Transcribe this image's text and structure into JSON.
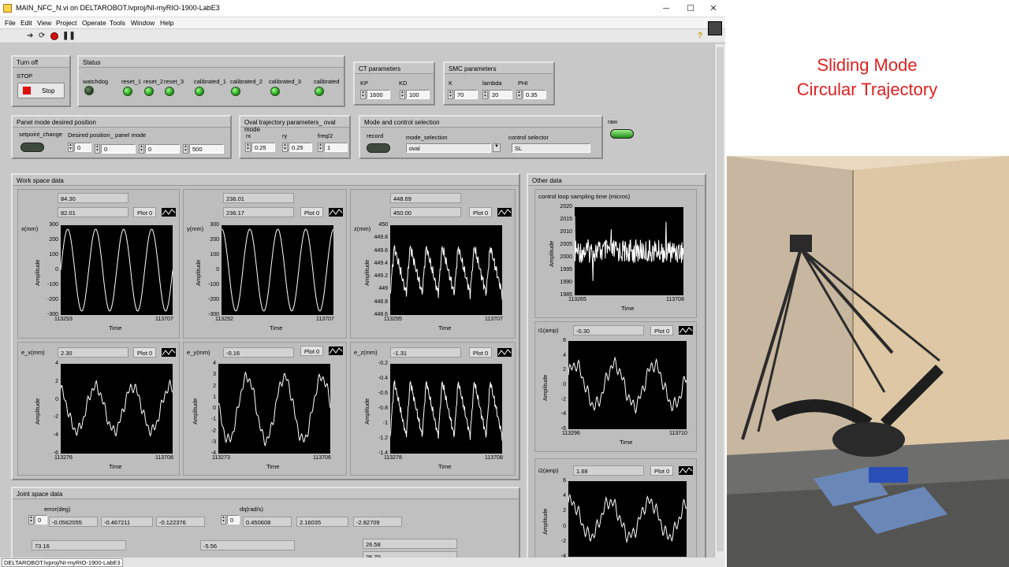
{
  "window": {
    "title": "MAIN_NFC_N.vi on DELTAROBOT.lvproj/NI-myRIO-1900-LabE3"
  },
  "menu": [
    "File",
    "Edit",
    "View",
    "Project",
    "Operate",
    "Tools",
    "Window",
    "Help"
  ],
  "status_path": "DELTAROBOT.lvproj/NI-myRIO-1900-LabE3",
  "turnoff": {
    "title": "Turn off",
    "stop_label": "STOP",
    "stop_btn": "Stop"
  },
  "status": {
    "title": "Status",
    "watchdog": "watchdog",
    "reset1": "reset_1",
    "reset2": "reset_2",
    "reset3": "reset_3",
    "cal1": "calibrated_1",
    "cal2": "calibrated_2",
    "cal3": "calibrated_3",
    "cal": "calibrated"
  },
  "ct": {
    "title": "CT parameters",
    "kp_label": "KP",
    "kp": "1600",
    "kd_label": "KD",
    "kd": "100"
  },
  "smc": {
    "title": "SMC parameters",
    "k_label": "K",
    "k": "70",
    "lambda_label": "lambda",
    "lambda": "20",
    "phi_label": "PHI",
    "phi": "0.35"
  },
  "panelmode": {
    "title": "Panel mode desired position",
    "setpoint": "setpoint_change",
    "desired": "Desired position_ panel mode",
    "idx": "0",
    "v1": "0",
    "v2": "0",
    "v3": "500"
  },
  "oval": {
    "title": "Oval trajectory parameters_ oval mode",
    "rx_label": "rx",
    "rx": "0.25",
    "ry_label": "ry",
    "ry": "0.25",
    "freq_label": "freq/2",
    "freq": "1"
  },
  "mode": {
    "title": "Mode and control selection",
    "record": "record",
    "mode_label": "mode_selection",
    "mode_value": "oval",
    "ctrl_label": "control selector",
    "ctrl_value": "SL"
  },
  "raw": "raw",
  "workspace": {
    "title": "Work space data",
    "plot_btn": "Plot 0",
    "amp": "Amplitude",
    "time": "Time",
    "x": {
      "label": "x(mm)",
      "v1": "84.30",
      "v2": "82.01",
      "yticks": [
        "300",
        "200",
        "100",
        "0",
        "-100",
        "-200",
        "-300"
      ],
      "xmin": "113293",
      "xmax": "113707"
    },
    "y": {
      "label": "y(mm)",
      "v1": "236.01",
      "v2": "236.17",
      "yticks": [
        "300",
        "200",
        "100",
        "0",
        "-100",
        "-200",
        "-300"
      ],
      "xmin": "113292",
      "xmax": "113707"
    },
    "z": {
      "label": "z(mm)",
      "v1": "448.69",
      "v2": "450.00",
      "yticks": [
        "450",
        "449.8",
        "449.6",
        "449.4",
        "449.2",
        "449",
        "448.8",
        "448.6"
      ],
      "xmin": "113295",
      "xmax": "113707"
    },
    "ex": {
      "label": "e_x(mm)",
      "v": "2.30",
      "yticks": [
        "4",
        "2",
        "0",
        "-2",
        "-4",
        "-6"
      ],
      "xmin": "113276",
      "xmax": "113708"
    },
    "ey": {
      "label": "e_y(mm)",
      "v": "-0.16",
      "yticks": [
        "4",
        "3",
        "2",
        "1",
        "0",
        "-1",
        "-2",
        "-3",
        "-4"
      ],
      "xmin": "113273",
      "xmax": "113706"
    },
    "ez": {
      "label": "e_z(mm)",
      "v": "-1.31",
      "yticks": [
        "-0.2",
        "-0.4",
        "-0.6",
        "-0.8",
        "-1",
        "-1.2",
        "-1.4"
      ],
      "xmin": "113278",
      "xmax": "113708"
    }
  },
  "other": {
    "title": "Other data",
    "loop_label": "control loop sampling time (micros)",
    "loop_yticks": [
      "2020",
      "2015",
      "2010",
      "2005",
      "2000",
      "1995",
      "1990",
      "1985"
    ],
    "loop_xmin": "113265",
    "loop_xmax": "113708",
    "i1_label": "i1(amp)",
    "i1": "-0.30",
    "i1_yticks": [
      "6",
      "4",
      "2",
      "0",
      "-2",
      "-4",
      "-6"
    ],
    "i1_xmin": "113296",
    "i1_xmax": "113710",
    "i2_label": "i2(amp)",
    "i2": "1.68",
    "i2_yticks": [
      "6",
      "4",
      "2",
      "0",
      "-2",
      "-4"
    ]
  },
  "joint": {
    "title": "Joint space data",
    "err_label": "error(deg)",
    "err_idx": "0",
    "e1": "-0.0562055",
    "e2": "-0.467211",
    "e3": "-0.122376",
    "dq_label": "dq(rad/s)",
    "dq_idx": "0",
    "d1": "0.450608",
    "d2": "2.16035",
    "d3": "-2.82709",
    "b1": "73.16",
    "b2": "-5.56",
    "b3": "26.58",
    "b3b": "26.70"
  },
  "caption": {
    "line1": "Sliding Mode",
    "line2": "Circular Trajectory"
  },
  "colors": {
    "led_on": "#22a01b",
    "caption": "#e01f1f",
    "stop": "#e01010"
  }
}
